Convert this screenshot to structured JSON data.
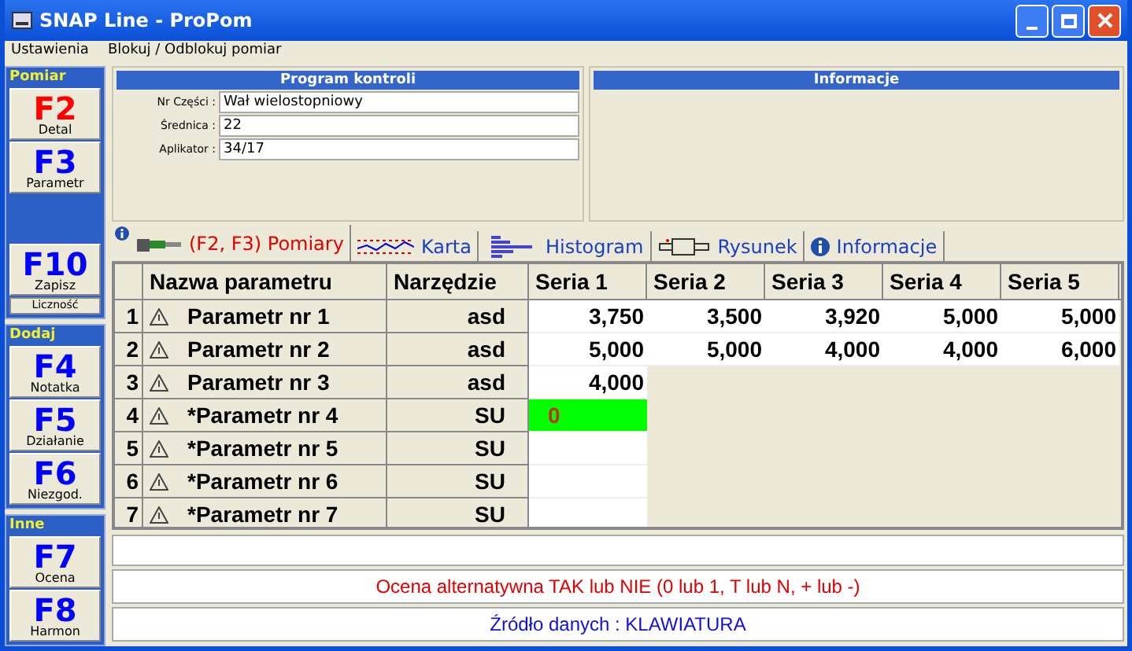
{
  "window": {
    "title": "SNAP Line - ProPom"
  },
  "menu": [
    "Ustawienia",
    "Blokuj / Odblokuj pomiar"
  ],
  "sidebar": [
    {
      "title": "Pomiar",
      "buttons": [
        {
          "kind": "key",
          "key": "F2",
          "label": "Detal",
          "color": "#ff0000"
        },
        {
          "kind": "key",
          "key": "F3",
          "label": "Parametr",
          "color": "#0000ff"
        },
        {
          "kind": "spacer"
        },
        {
          "kind": "key",
          "key": "F10",
          "label": "Zapisz",
          "color": "#0000ff"
        },
        {
          "kind": "small",
          "label": "Liczność"
        }
      ]
    },
    {
      "title": "Dodaj",
      "buttons": [
        {
          "kind": "key",
          "key": "F4",
          "label": "Notatka",
          "color": "#0000ff"
        },
        {
          "kind": "key",
          "key": "F5",
          "label": "Działanie",
          "color": "#0000ff"
        },
        {
          "kind": "key",
          "key": "F6",
          "label": "Niezgod.",
          "color": "#0000ff"
        }
      ]
    },
    {
      "title": "Inne",
      "buttons": [
        {
          "kind": "key",
          "key": "F7",
          "label": "Ocena",
          "color": "#0000ff"
        },
        {
          "kind": "key",
          "key": "F8",
          "label": "Harmon",
          "color": "#0000ff"
        }
      ]
    }
  ],
  "program_panel": {
    "title": "Program kontroli",
    "fields": [
      {
        "label": "Nr Części :",
        "value": "Wał wielostopniowy"
      },
      {
        "label": "Średnica :",
        "value": "22"
      },
      {
        "label": "Aplikator :",
        "value": "34/17"
      }
    ]
  },
  "info_panel": {
    "title": "Informacje"
  },
  "tabs": [
    {
      "label": "(F2, F3) Pomiary",
      "kind": "caliper",
      "selected": true
    },
    {
      "label": "Karta",
      "kind": "chart",
      "selected": false
    },
    {
      "label": "Histogram",
      "kind": "histogram",
      "selected": false
    },
    {
      "label": "Rysunek",
      "kind": "drawing",
      "selected": false
    },
    {
      "label": "Informacje",
      "kind": "info",
      "selected": false
    }
  ],
  "table": {
    "columns": [
      "Nazwa parametru",
      "Narzędzie",
      "Seria 1",
      "Seria 2",
      "Seria 3",
      "Seria 4",
      "Seria 5"
    ],
    "rows": [
      {
        "num": "1",
        "name": "Parametr nr 1",
        "tool": "asd",
        "values": [
          {
            "text": "3,750",
            "editing": false
          },
          {
            "text": "3,500",
            "editing": false
          },
          {
            "text": "3,920",
            "editing": false
          },
          {
            "text": "5,000",
            "editing": false
          },
          {
            "text": "5,000",
            "editing": false
          }
        ]
      },
      {
        "num": "2",
        "name": "Parametr nr 2",
        "tool": "asd",
        "values": [
          {
            "text": "5,000",
            "editing": false
          },
          {
            "text": "5,000",
            "editing": false
          },
          {
            "text": "4,000",
            "editing": false
          },
          {
            "text": "4,000",
            "editing": false
          },
          {
            "text": "6,000",
            "editing": false
          }
        ]
      },
      {
        "num": "3",
        "name": "Parametr nr 3",
        "tool": "asd",
        "values": [
          {
            "text": "4,000",
            "editing": false
          }
        ]
      },
      {
        "num": "4",
        "name": "*Parametr nr 4",
        "tool": "SU",
        "values": [
          {
            "text": "0",
            "editing": true
          }
        ]
      },
      {
        "num": "5",
        "name": "*Parametr nr 5",
        "tool": "SU",
        "values": []
      },
      {
        "num": "6",
        "name": "*Parametr nr 6",
        "tool": "SU",
        "values": []
      },
      {
        "num": "7",
        "name": "*Parametr nr 7",
        "tool": "SU",
        "values": []
      }
    ]
  },
  "hint": "Ocena alternatywna TAK lub NIE (0 lub 1, T lub N, + lub -)",
  "source": "Źródło danych : KLAWIATURA"
}
